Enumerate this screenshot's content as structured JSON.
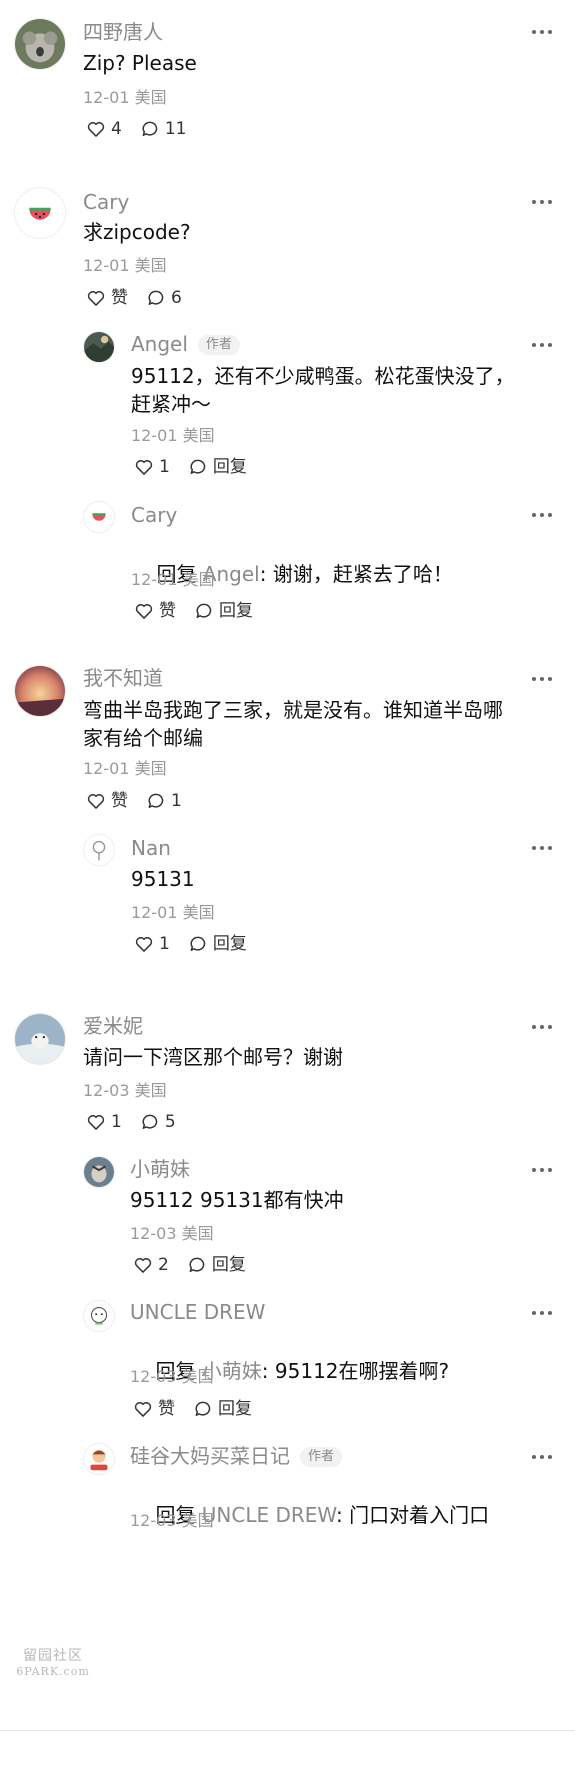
{
  "labels": {
    "like": "赞",
    "reply": "回复",
    "author_tag": "作者"
  },
  "comments": [
    {
      "name": "四野唐人",
      "text": "Zip? Please",
      "date": "12-01",
      "location": "美国",
      "likes": "4",
      "replies": "11"
    },
    {
      "name": "Cary",
      "text": "求zipcode?",
      "date": "12-01",
      "location": "美国",
      "likes": "赞",
      "replies": "6"
    },
    {
      "name": "Angel",
      "text": "95112，还有不少咸鸭蛋。松花蛋快没了，\n赶紧冲～",
      "date": "12-01",
      "location": "美国",
      "likes": "1"
    },
    {
      "name": "Cary",
      "reply_to": "Angel",
      "text": ": 谢谢，赶紧去了哈！",
      "date": "12-01",
      "location": "美国",
      "likes": "赞"
    },
    {
      "name": "我不知道",
      "text": "弯曲半岛我跑了三家，就是没有。谁知道半岛哪\n家有给个邮编",
      "date": "12-01",
      "location": "美国",
      "likes": "赞",
      "replies": "1"
    },
    {
      "name": "Nan",
      "text": "95131",
      "date": "12-01",
      "location": "美国",
      "likes": "1"
    },
    {
      "name": "爱米妮",
      "text": "请问一下湾区那个邮号？谢谢",
      "date": "12-03",
      "location": "美国",
      "likes": "1",
      "replies": "5"
    },
    {
      "name": "小萌妹",
      "text": "95112 95131都有快冲",
      "date": "12-03",
      "location": "美国",
      "likes": "2"
    },
    {
      "name": "UNCLE DREW",
      "reply_to": "小萌妹",
      "text": ": 95112在哪摆着啊?",
      "date": "12-03",
      "location": "美国",
      "likes": "赞"
    },
    {
      "name": "硅谷大妈买菜日记",
      "reply_to": "UNCLE DREW",
      "text": ": 门口对着入门口",
      "date": "12-03",
      "location": "美国"
    }
  ],
  "watermark": {
    "line1": "留园社区",
    "line2": "6PARK.com"
  },
  "icons": [
    "more-icon",
    "heart-icon",
    "comment-icon",
    "reply-icon"
  ],
  "colors": {
    "name": "#8a8a8a",
    "meta": "#9a9a9a",
    "text": "#111111"
  }
}
